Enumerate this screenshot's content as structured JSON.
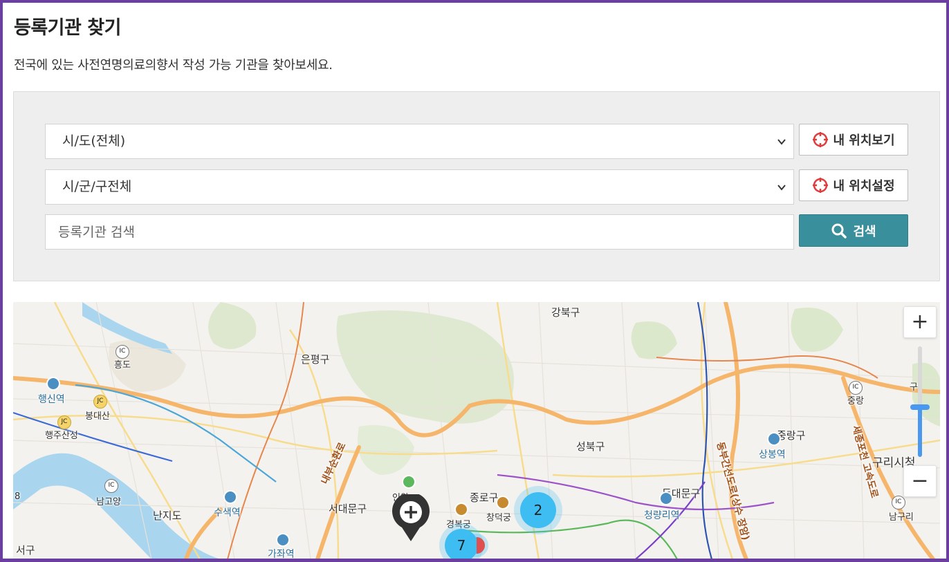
{
  "page": {
    "title": "등록기관 찾기",
    "subtitle": "전국에 있는 사전연명의료의향서 작성 가능 기관을 찾아보세요."
  },
  "search": {
    "sido_select": {
      "selected": "시/도(전체)"
    },
    "sigungu_select": {
      "selected": "시/군/구전체"
    },
    "keyword_input": {
      "value": "",
      "placeholder": "등록기관 검색"
    },
    "my_location_view_label": "내 위치보기",
    "my_location_set_label": "내 위치설정",
    "search_button_label": "검색"
  },
  "colors": {
    "accent": "#3a8f9c",
    "frame": "#6a3fa0",
    "location_icon": "#e03c3c",
    "cluster": "#3dbdf2",
    "zoom_slider": "#4a98f0"
  },
  "map": {
    "labels": {
      "gangbuk": "강북구",
      "eunpyeong": "은평구",
      "heungdo": "흥도",
      "ic_heungdo": "IC",
      "haengsin": "행신역",
      "jc_bongdae": "JC",
      "bongdaesan": "봉대산",
      "jc_haengju": "JC",
      "haengjusanseong": "행주산성",
      "ic_namgoyang": "IC",
      "namgoyang": "남고양",
      "nanjido": "난지도",
      "susaek": "수색역",
      "gajwa": "가좌역",
      "seogu": "서구",
      "eight": "8",
      "seodaemun": "서대문구",
      "jongno": "종로구",
      "gyeongbokgung": "경복궁",
      "changdeokgung": "창덕궁",
      "seongbuk": "성북구",
      "dongdaemun": "동대문구",
      "cheongnyangni": "청량리역",
      "jungnang": "중랑구",
      "sangbong": "상봉역",
      "ic_jungnang": "IC",
      "jungnang_ic": "중랑",
      "guri": "구리시청",
      "ic_namguri": "IC",
      "namguri": "남구리",
      "ansan": "인왕",
      "road_naebu": "내부순환로",
      "road_dongbu": "동부간선도로(상수 장암)",
      "road_sejong": "세종포천 고속도로",
      "gu_top": "구"
    },
    "clusters": [
      {
        "count": "2"
      },
      {
        "count": "7"
      }
    ],
    "zoom": {
      "plus_label": "+",
      "minus_label": "−",
      "level_fraction": 0.45
    }
  }
}
